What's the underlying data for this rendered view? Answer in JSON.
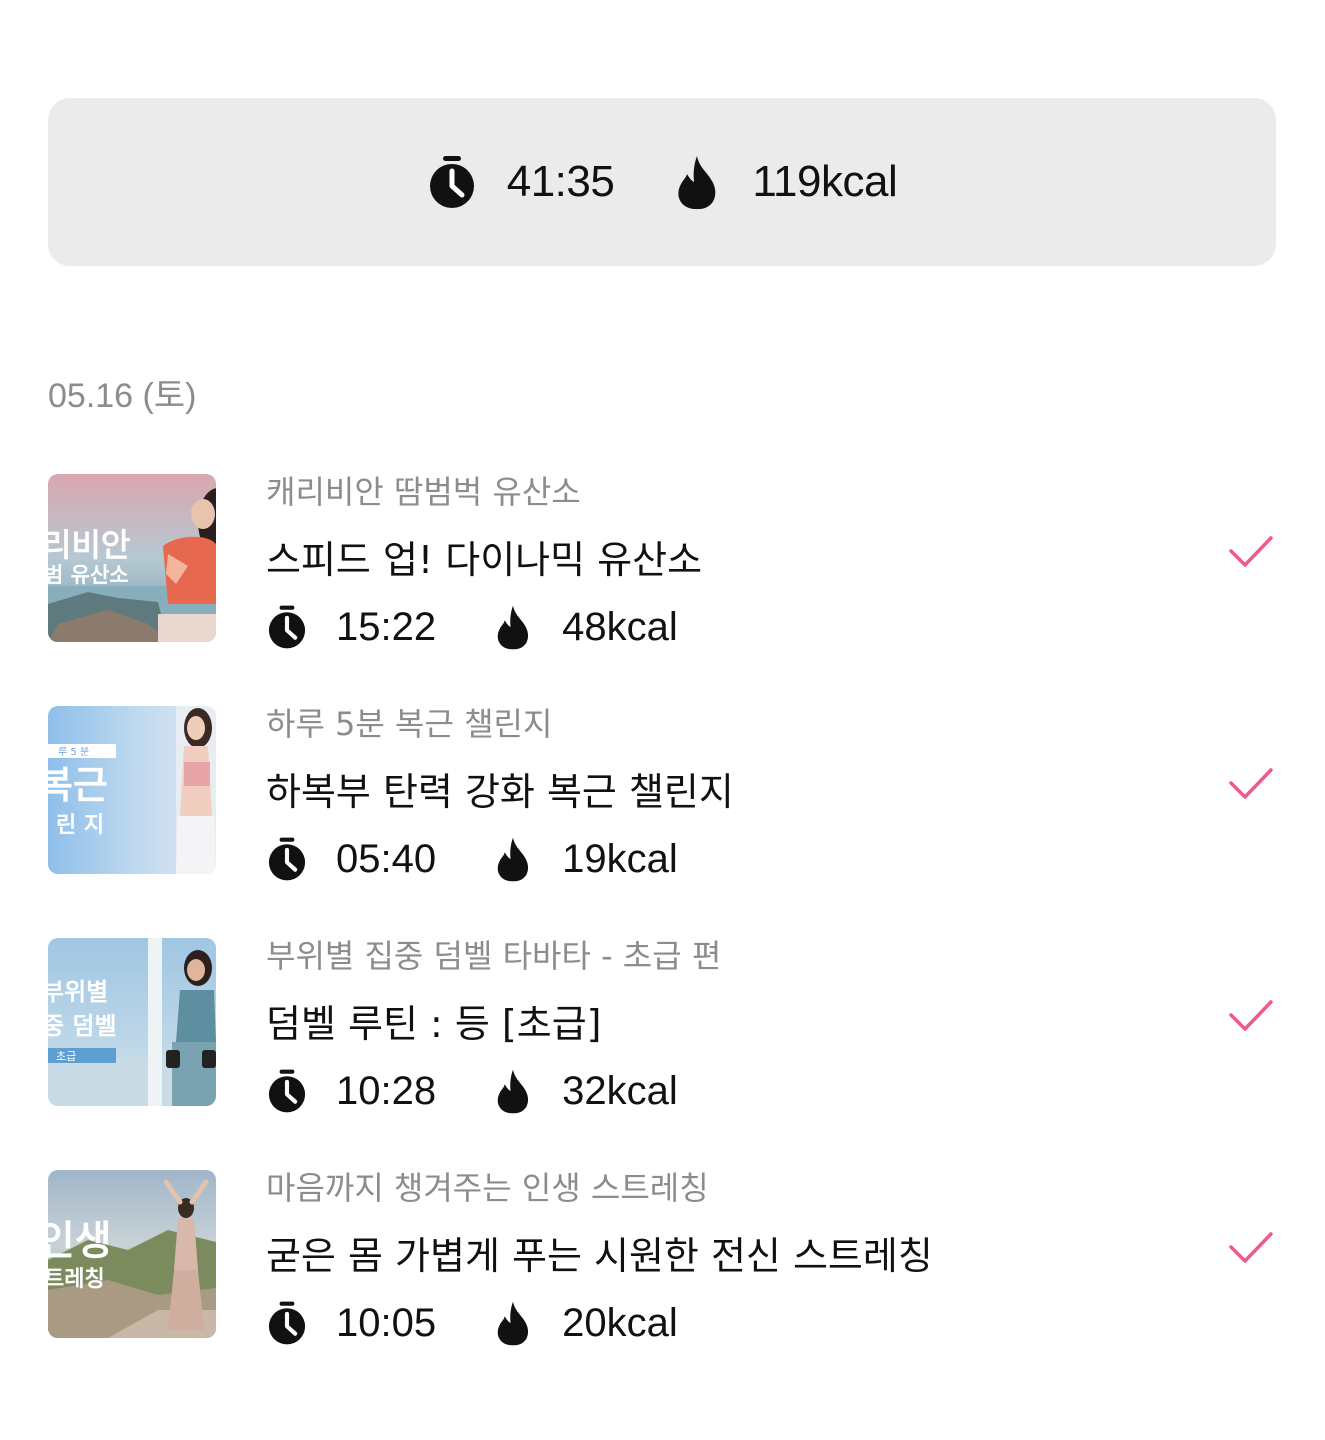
{
  "summary": {
    "total_time": "41:35",
    "total_kcal": "119kcal",
    "time_icon": "stopwatch-icon",
    "kcal_icon": "flame-icon"
  },
  "date_header": "05.16 (토)",
  "accent_color": "#ec5a8f",
  "workouts": [
    {
      "program": "캐리비안 땀범벅 유산소",
      "title": "스피드 업! 다이나믹 유산소",
      "time": "15:22",
      "kcal": "48kcal",
      "thumb_text": [
        "리비안",
        "범 유산소"
      ],
      "completed": true
    },
    {
      "program": "하루 5분 복근 챌린지",
      "title": "하복부 탄력 강화 복근 챌린지",
      "time": "05:40",
      "kcal": "19kcal",
      "thumb_text": [
        "루 5 분",
        "복근",
        "린 지"
      ],
      "completed": true
    },
    {
      "program": "부위별 집중 덤벨 타바타 - 초급 편",
      "title": "덤벨 루틴 : 등 [초급]",
      "time": "10:28",
      "kcal": "32kcal",
      "thumb_text": [
        "부위별",
        "중 덤벨",
        "초급"
      ],
      "completed": true
    },
    {
      "program": "마음까지 챙겨주는 인생 스트레칭",
      "title": "굳은 몸 가볍게 푸는 시원한 전신 스트레칭",
      "time": "10:05",
      "kcal": "20kcal",
      "thumb_text": [
        "인생",
        "트레칭"
      ],
      "completed": true
    }
  ]
}
